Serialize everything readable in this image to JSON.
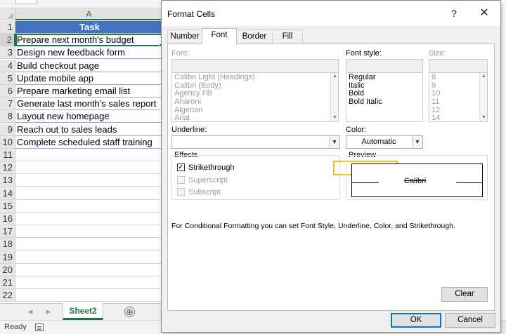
{
  "sheet": {
    "column_header": "A",
    "rows": [
      {
        "num": "1",
        "text": "Task"
      },
      {
        "num": "2",
        "text": "Prepare next month's budget"
      },
      {
        "num": "3",
        "text": "Design new feedback form"
      },
      {
        "num": "4",
        "text": "Build checkout page"
      },
      {
        "num": "5",
        "text": "Update mobile app"
      },
      {
        "num": "6",
        "text": "Prepare marketing email list"
      },
      {
        "num": "7",
        "text": "Generate last month's sales report"
      },
      {
        "num": "8",
        "text": "Layout new homepage"
      },
      {
        "num": "9",
        "text": "Reach out to sales leads"
      },
      {
        "num": "10",
        "text": "Complete scheduled staff training"
      },
      {
        "num": "11",
        "text": ""
      },
      {
        "num": "12",
        "text": ""
      },
      {
        "num": "13",
        "text": ""
      },
      {
        "num": "14",
        "text": ""
      },
      {
        "num": "15",
        "text": ""
      },
      {
        "num": "16",
        "text": ""
      },
      {
        "num": "17",
        "text": ""
      },
      {
        "num": "18",
        "text": ""
      },
      {
        "num": "19",
        "text": ""
      },
      {
        "num": "20",
        "text": ""
      },
      {
        "num": "21",
        "text": ""
      },
      {
        "num": "22",
        "text": ""
      }
    ],
    "header_fill": "#4472c4",
    "accent": "#217346",
    "tab_label": "Sheet2",
    "add_sheet": "⊕",
    "nav_prev": "◀",
    "nav_next": "▶",
    "status": "Ready"
  },
  "dialog": {
    "title": "Format Cells",
    "help": "?",
    "close": "✕",
    "tabs": [
      "Number",
      "Font",
      "Border",
      "Fill"
    ],
    "active_tab": "Font",
    "font_label": "Font:",
    "font_style_label": "Font style:",
    "size_label": "Size:",
    "fonts": [
      "Calibri Light (Headings)",
      "Calibri (Body)",
      "Agency FB",
      "Aharoni",
      "Algerian",
      "Arial"
    ],
    "styles": [
      "Regular",
      "Italic",
      "Bold",
      "Bold Italic"
    ],
    "sizes": [
      "8",
      "9",
      "10",
      "11",
      "12",
      "14"
    ],
    "underline_label": "Underline:",
    "color_label": "Color:",
    "color_value": "Automatic",
    "effects_label": "Effects",
    "effects": [
      {
        "label": "Strikethrough",
        "checked": true,
        "enabled": true
      },
      {
        "label": "Superscript",
        "checked": false,
        "enabled": false
      },
      {
        "label": "Subscript",
        "checked": false,
        "enabled": false
      }
    ],
    "preview_label": "Preview",
    "preview_text": "Calibri",
    "info_text": "For Conditional Formatting you can set Font Style, Underline, Color, and Strikethrough.",
    "clear_label": "Clear",
    "ok_label": "OK",
    "cancel_label": "Cancel",
    "highlight_color": "#f0c020"
  }
}
